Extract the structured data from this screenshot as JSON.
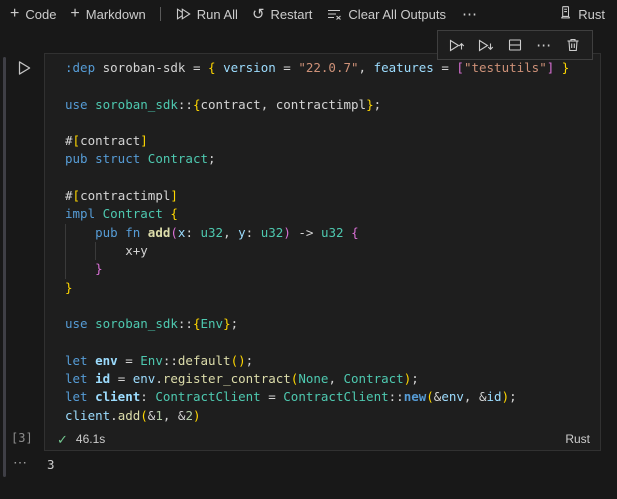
{
  "palette": {
    "kw": "#569cd6",
    "ty": "#4ec9b0",
    "fn": "#dcdcaa",
    "va": "#9cdcfe",
    "st": "#ce9178",
    "nu": "#b5cea8",
    "fg": "#d4d4d4",
    "b1": "#ffd700",
    "b2": "#da70d6",
    "check_green": "#73c991",
    "icon_gray": "#cccccc"
  },
  "toolbar": {
    "code_label": "Code",
    "markdown_label": "Markdown",
    "run_all_label": "Run All",
    "restart_label": "Restart",
    "clear_all_label": "Clear All Outputs",
    "more_label": "⋯",
    "kernel_label": "Rust"
  },
  "cell_toolbar": {
    "more_label": "⋯"
  },
  "cell": {
    "execution_count": "[3]",
    "status": {
      "duration": "46.1s",
      "language": "Rust"
    },
    "code": {
      "lines": [
        {
          "tokens": [
            {
              "t": ":dep",
              "c": "kw"
            },
            {
              "t": " soroban-sdk = ",
              "c": "fg"
            },
            {
              "t": "{",
              "c": "b1"
            },
            {
              "t": " ",
              "c": "fg"
            },
            {
              "t": "version",
              "c": "va"
            },
            {
              "t": " = ",
              "c": "fg"
            },
            {
              "t": "\"22.0.7\"",
              "c": "st"
            },
            {
              "t": ", ",
              "c": "fg"
            },
            {
              "t": "features",
              "c": "va"
            },
            {
              "t": " = ",
              "c": "fg"
            },
            {
              "t": "[",
              "c": "b2"
            },
            {
              "t": "\"testutils\"",
              "c": "st"
            },
            {
              "t": "]",
              "c": "b2"
            },
            {
              "t": " ",
              "c": "fg"
            },
            {
              "t": "}",
              "c": "b1"
            }
          ]
        },
        {
          "tokens": []
        },
        {
          "tokens": [
            {
              "t": "use",
              "c": "kw"
            },
            {
              "t": " ",
              "c": "fg"
            },
            {
              "t": "soroban_sdk",
              "c": "ty"
            },
            {
              "t": "::",
              "c": "fg"
            },
            {
              "t": "{",
              "c": "b1"
            },
            {
              "t": "contract, contractimpl",
              "c": "fg"
            },
            {
              "t": "}",
              "c": "b1"
            },
            {
              "t": ";",
              "c": "fg"
            }
          ]
        },
        {
          "tokens": []
        },
        {
          "tokens": [
            {
              "t": "#",
              "c": "fg"
            },
            {
              "t": "[",
              "c": "b1"
            },
            {
              "t": "contract",
              "c": "fg"
            },
            {
              "t": "]",
              "c": "b1"
            }
          ]
        },
        {
          "tokens": [
            {
              "t": "pub struct",
              "c": "kw"
            },
            {
              "t": " ",
              "c": "fg"
            },
            {
              "t": "Contract",
              "c": "ty"
            },
            {
              "t": ";",
              "c": "fg"
            }
          ]
        },
        {
          "tokens": []
        },
        {
          "tokens": [
            {
              "t": "#",
              "c": "fg"
            },
            {
              "t": "[",
              "c": "b1"
            },
            {
              "t": "contractimpl",
              "c": "fg"
            },
            {
              "t": "]",
              "c": "b1"
            }
          ]
        },
        {
          "tokens": [
            {
              "t": "impl",
              "c": "kw"
            },
            {
              "t": " ",
              "c": "fg"
            },
            {
              "t": "Contract",
              "c": "ty"
            },
            {
              "t": " ",
              "c": "fg"
            },
            {
              "t": "{",
              "c": "b1"
            }
          ]
        },
        {
          "guides": [
            0
          ],
          "tokens": [
            {
              "t": "    ",
              "c": "fg"
            },
            {
              "t": "pub fn",
              "c": "kw"
            },
            {
              "t": " ",
              "c": "fg"
            },
            {
              "t": "add",
              "c": "fn",
              "b": 1
            },
            {
              "t": "(",
              "c": "b2"
            },
            {
              "t": "x",
              "c": "va"
            },
            {
              "t": ": ",
              "c": "fg"
            },
            {
              "t": "u32",
              "c": "ty"
            },
            {
              "t": ", ",
              "c": "fg"
            },
            {
              "t": "y",
              "c": "va"
            },
            {
              "t": ": ",
              "c": "fg"
            },
            {
              "t": "u32",
              "c": "ty"
            },
            {
              "t": ")",
              "c": "b2"
            },
            {
              "t": " -> ",
              "c": "fg"
            },
            {
              "t": "u32",
              "c": "ty"
            },
            {
              "t": " ",
              "c": "fg"
            },
            {
              "t": "{",
              "c": "b2"
            }
          ]
        },
        {
          "guides": [
            0,
            4
          ],
          "tokens": [
            {
              "t": "        x+y",
              "c": "fg"
            }
          ]
        },
        {
          "guides": [
            0
          ],
          "tokens": [
            {
              "t": "    ",
              "c": "fg"
            },
            {
              "t": "}",
              "c": "b2"
            }
          ]
        },
        {
          "tokens": [
            {
              "t": "}",
              "c": "b1"
            }
          ]
        },
        {
          "tokens": []
        },
        {
          "tokens": [
            {
              "t": "use",
              "c": "kw"
            },
            {
              "t": " ",
              "c": "fg"
            },
            {
              "t": "soroban_sdk",
              "c": "ty"
            },
            {
              "t": "::",
              "c": "fg"
            },
            {
              "t": "{",
              "c": "b1"
            },
            {
              "t": "Env",
              "c": "ty"
            },
            {
              "t": "}",
              "c": "b1"
            },
            {
              "t": ";",
              "c": "fg"
            }
          ]
        },
        {
          "tokens": []
        },
        {
          "tokens": [
            {
              "t": "let",
              "c": "kw"
            },
            {
              "t": " ",
              "c": "fg"
            },
            {
              "t": "env",
              "c": "va",
              "b": 1
            },
            {
              "t": " = ",
              "c": "fg"
            },
            {
              "t": "Env",
              "c": "ty"
            },
            {
              "t": "::",
              "c": "fg"
            },
            {
              "t": "default",
              "c": "fn"
            },
            {
              "t": "(",
              "c": "b1"
            },
            {
              "t": ")",
              "c": "b1"
            },
            {
              "t": ";",
              "c": "fg"
            }
          ]
        },
        {
          "tokens": [
            {
              "t": "let",
              "c": "kw"
            },
            {
              "t": " ",
              "c": "fg"
            },
            {
              "t": "id",
              "c": "va",
              "b": 1
            },
            {
              "t": " = ",
              "c": "fg"
            },
            {
              "t": "env",
              "c": "va"
            },
            {
              "t": ".",
              "c": "fg"
            },
            {
              "t": "register_contract",
              "c": "fn"
            },
            {
              "t": "(",
              "c": "b1"
            },
            {
              "t": "None",
              "c": "ty"
            },
            {
              "t": ", ",
              "c": "fg"
            },
            {
              "t": "Contract",
              "c": "ty"
            },
            {
              "t": ")",
              "c": "b1"
            },
            {
              "t": ";",
              "c": "fg"
            }
          ]
        },
        {
          "tokens": [
            {
              "t": "let",
              "c": "kw"
            },
            {
              "t": " ",
              "c": "fg"
            },
            {
              "t": "client",
              "c": "va",
              "b": 1
            },
            {
              "t": ": ",
              "c": "fg"
            },
            {
              "t": "ContractClient",
              "c": "ty"
            },
            {
              "t": " = ",
              "c": "fg"
            },
            {
              "t": "ContractClient",
              "c": "ty"
            },
            {
              "t": "::",
              "c": "fg"
            },
            {
              "t": "new",
              "c": "kw",
              "b": 1
            },
            {
              "t": "(",
              "c": "b1"
            },
            {
              "t": "&",
              "c": "fg"
            },
            {
              "t": "env",
              "c": "va"
            },
            {
              "t": ", ",
              "c": "fg"
            },
            {
              "t": "&",
              "c": "fg"
            },
            {
              "t": "id",
              "c": "va"
            },
            {
              "t": ")",
              "c": "b1"
            },
            {
              "t": ";",
              "c": "fg"
            }
          ]
        },
        {
          "tokens": [
            {
              "t": "client",
              "c": "va"
            },
            {
              "t": ".",
              "c": "fg"
            },
            {
              "t": "add",
              "c": "fn"
            },
            {
              "t": "(",
              "c": "b1"
            },
            {
              "t": "&",
              "c": "fg"
            },
            {
              "t": "1",
              "c": "nu"
            },
            {
              "t": ", ",
              "c": "fg"
            },
            {
              "t": "&",
              "c": "fg"
            },
            {
              "t": "2",
              "c": "nu"
            },
            {
              "t": ")",
              "c": "b1"
            }
          ]
        }
      ]
    }
  },
  "output": {
    "more_label": "⋯",
    "value": "3"
  }
}
